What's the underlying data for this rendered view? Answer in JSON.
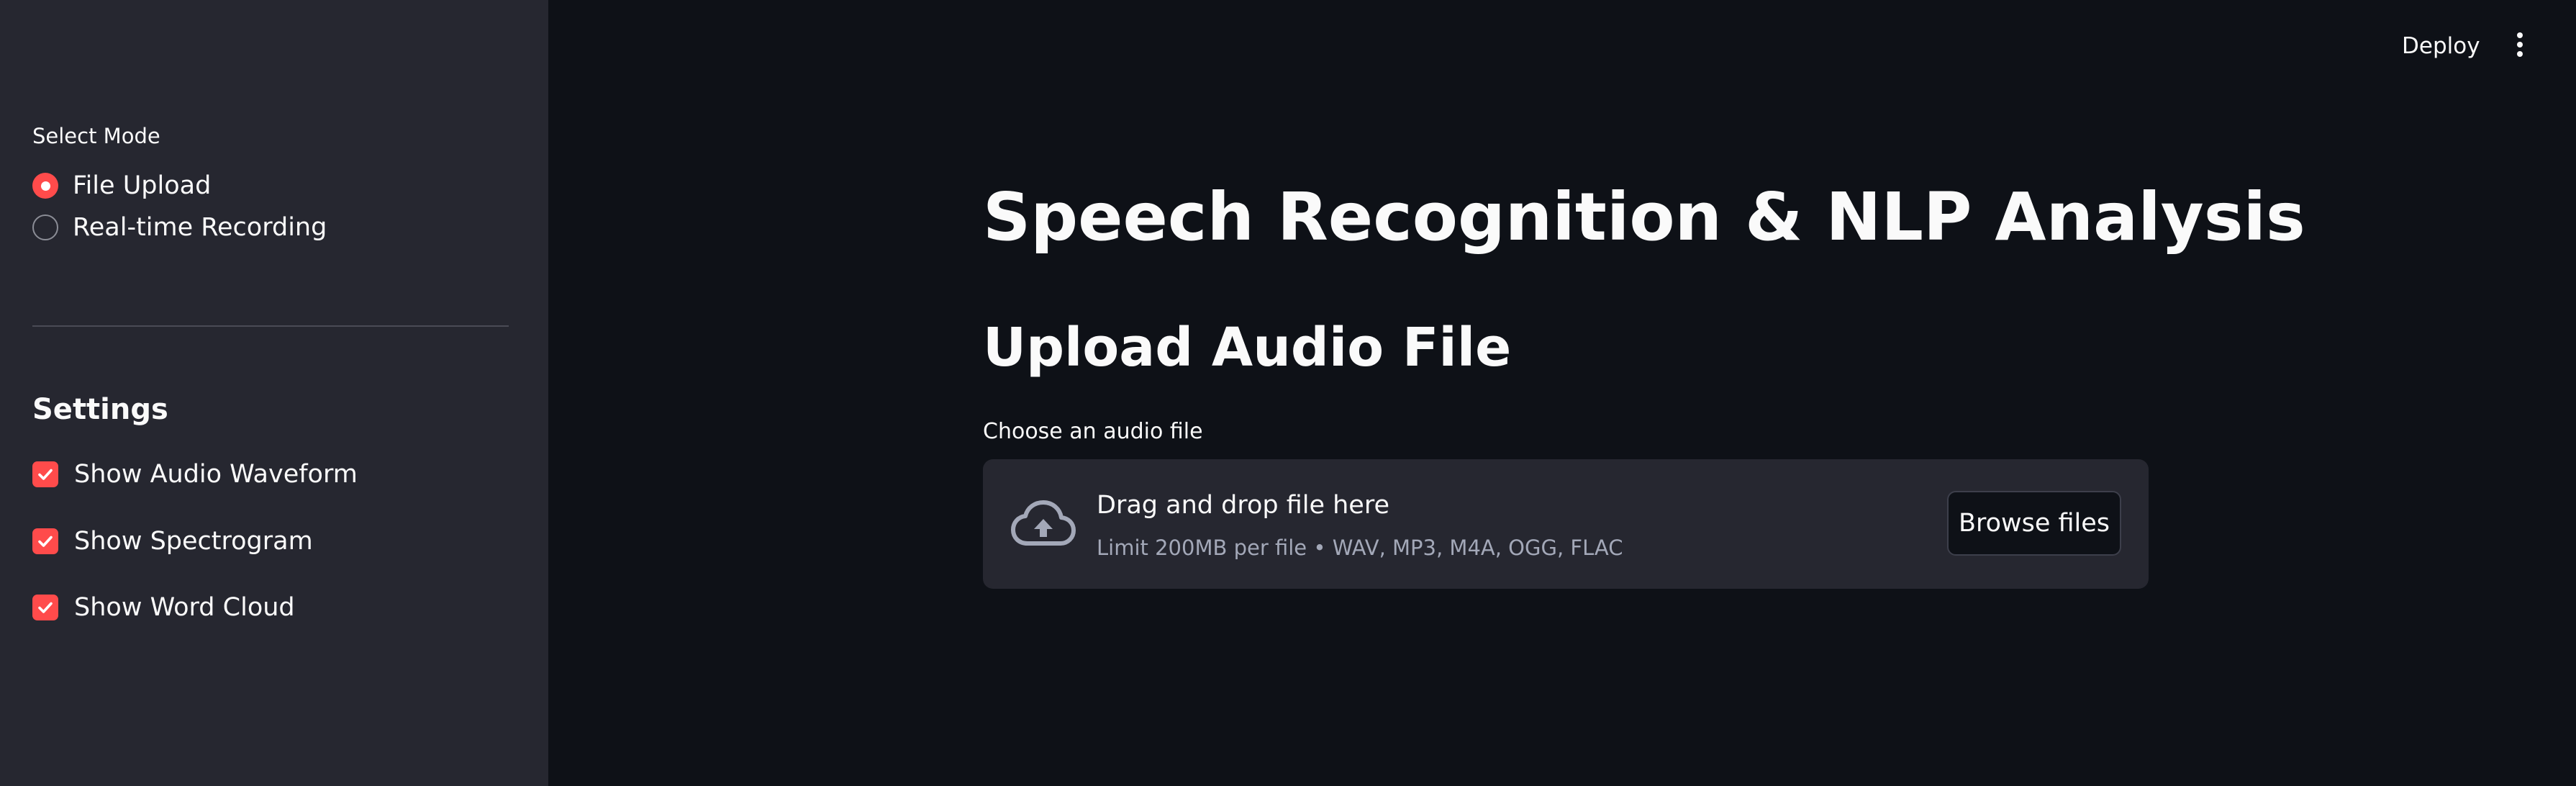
{
  "sidebar": {
    "mode_label": "Select Mode",
    "modes": [
      {
        "label": "File Upload",
        "selected": true
      },
      {
        "label": "Real-time Recording",
        "selected": false
      }
    ],
    "settings_heading": "Settings",
    "settings": [
      {
        "label": "Show Audio Waveform",
        "checked": true
      },
      {
        "label": "Show Spectrogram",
        "checked": true
      },
      {
        "label": "Show Word Cloud",
        "checked": true
      }
    ]
  },
  "header": {
    "deploy_label": "Deploy",
    "menu_icon": "vertical-ellipsis-icon"
  },
  "main": {
    "title": "Speech Recognition & NLP Analysis",
    "subtitle": "Upload Audio File",
    "uploader": {
      "label": "Choose an audio file",
      "drop_text": "Drag and drop file here",
      "limit_text": "Limit 200MB per file • WAV, MP3, M4A, OGG, FLAC",
      "browse_label": "Browse files",
      "icon": "cloud-upload-icon"
    }
  },
  "colors": {
    "accent": "#ff4b4b",
    "background": "#0e1117",
    "sidebar_background": "#262730",
    "text": "#fafafa",
    "muted_text": "#a3a8b8"
  }
}
